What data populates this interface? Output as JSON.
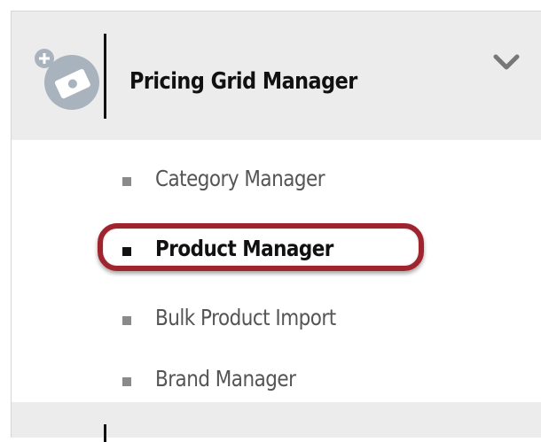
{
  "menu": {
    "section": {
      "title": "Pricing Grid Manager",
      "icon": "pricing-grid-icon",
      "expand_icon": "chevron-down-icon"
    },
    "items": [
      {
        "label": "Category Manager",
        "active": false
      },
      {
        "label": "Product Manager",
        "active": true
      },
      {
        "label": "Bulk Product Import",
        "active": false
      },
      {
        "label": "Brand Manager",
        "active": false
      }
    ]
  },
  "colors": {
    "header_bg": "#ececec",
    "highlight_ring": "#a0242e",
    "icon_fill": "#a9b3bd",
    "text_active": "#111111",
    "text_inactive": "#555555"
  }
}
